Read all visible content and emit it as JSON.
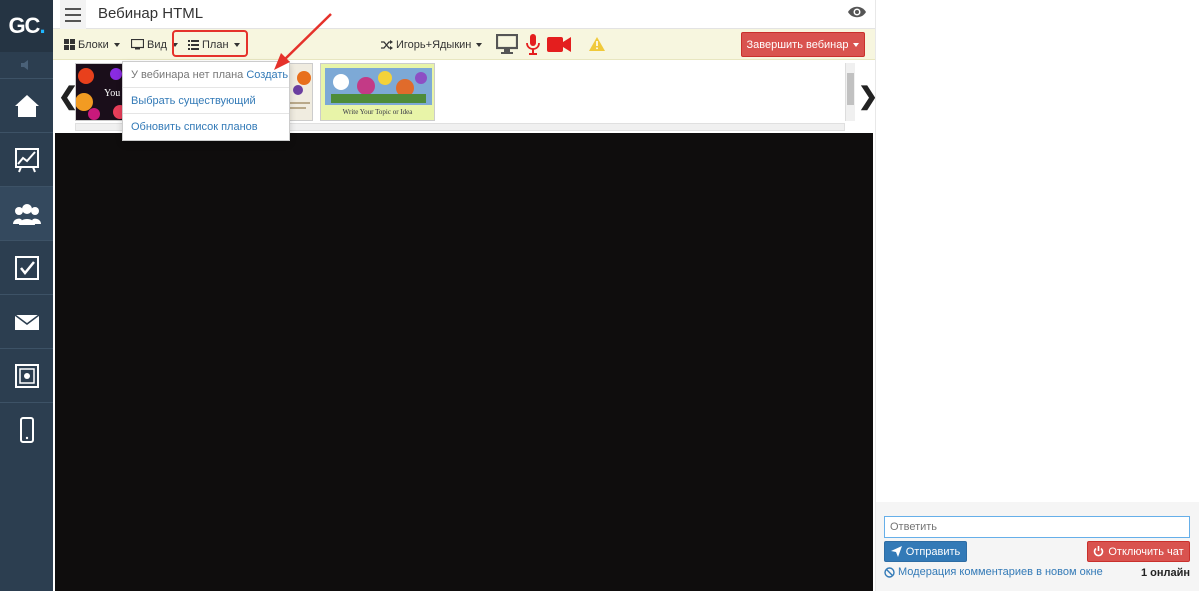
{
  "sidebar": {
    "logo": "GC",
    "logo_dot": ".",
    "items": [
      {
        "icon": "home-icon"
      },
      {
        "icon": "chart-icon"
      },
      {
        "icon": "users-icon"
      },
      {
        "icon": "checkbox-icon"
      },
      {
        "icon": "mail-icon"
      },
      {
        "icon": "safe-icon"
      },
      {
        "icon": "mobile-icon"
      }
    ]
  },
  "header": {
    "title": "Вебинар HTML"
  },
  "toolbar": {
    "blocks_label": "Блоки",
    "view_label": "Вид",
    "plan_label": "План",
    "speakers_label": "Игорь+Ядыкин",
    "finish_label": "Завершить вебинар"
  },
  "thumbnails": {
    "first_text": "You",
    "third_caption": "Write Your Topic or Idea"
  },
  "plan_dropdown": {
    "no_plan_text": "У вебинара нет плана",
    "create_link": "Создать",
    "choose_existing": "Выбрать существующий",
    "refresh_plans": "Обновить список планов"
  },
  "chat": {
    "reply_placeholder": "Ответить",
    "send_label": "Отправить",
    "disable_chat_label": "Отключить чат",
    "moderation_link": "Модерация комментариев в новом окне",
    "online_count": "1 онлайн"
  },
  "colors": {
    "sidebar_bg": "#2c3e50",
    "toolbar_bg": "#f7f6df",
    "danger": "#d9534f",
    "primary": "#337ab7",
    "annotation": "#e5322b"
  }
}
